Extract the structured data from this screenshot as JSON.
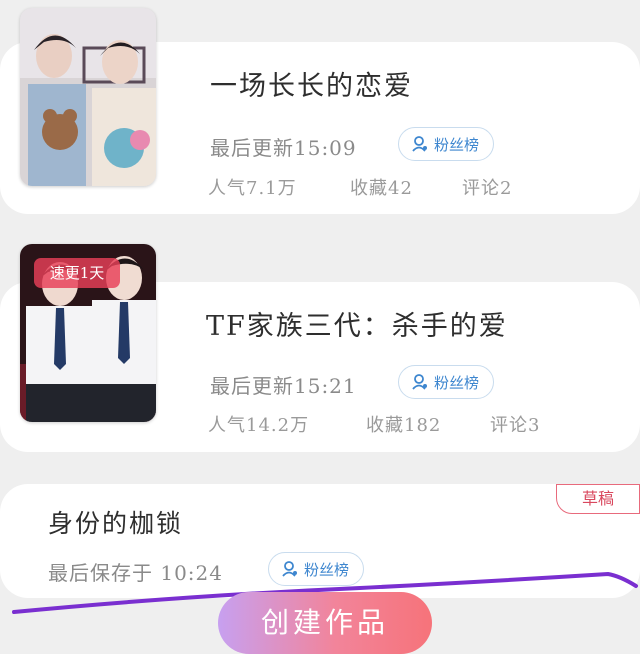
{
  "works": [
    {
      "title": "一场长长的恋爱",
      "last_update": "最后更新15:09",
      "fans_label": "粉丝榜",
      "popularity": "人气7.1万",
      "favorites": "收藏42",
      "comments": "评论2"
    },
    {
      "badge": "速更1天",
      "title": "TF家族三代：杀手的爱",
      "last_update": "最后更新15:21",
      "fans_label": "粉丝榜",
      "popularity": "人气14.2万",
      "favorites": "收藏182",
      "comments": "评论3"
    }
  ],
  "draft": {
    "badge": "草稿",
    "title": "身份的枷锁",
    "last_saved": "最后保存于 10:24",
    "fans_label": "粉丝榜"
  },
  "create_button": "创建作品",
  "colors": {
    "accent_blue": "#3d86cf",
    "draft_red": "#d9485e",
    "annotation_purple": "#7a2fd0",
    "button_gradient_start": "#c7a0f0",
    "button_gradient_end": "#f6737a"
  }
}
